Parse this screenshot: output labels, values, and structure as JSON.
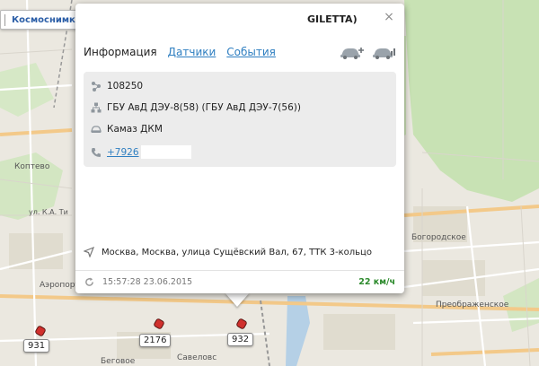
{
  "layer_bar": {
    "selected_layer": "Космоснимки Роскосмос",
    "search_placeholder": ""
  },
  "popup": {
    "title_fragment": "GILETTA)",
    "tabs": [
      {
        "label": "Информация",
        "active": true
      },
      {
        "label": "Датчики",
        "active": false
      },
      {
        "label": "События",
        "active": false
      }
    ],
    "info": {
      "id": "108250",
      "organization": "ГБУ АвД ДЭУ-8(58) (ГБУ АвД ДЭУ-7(56))",
      "vehicle_model": "Камаз ДКМ",
      "phone": "+7926"
    },
    "address": "Москва, Москва, улица Сущёвский Вал, 67, ТТК 3-кольцо",
    "timestamp": "15:57:28 23.06.2015",
    "speed": "22 км/ч"
  },
  "map": {
    "labels": [
      {
        "id": "koptevo",
        "text": "Коптево"
      },
      {
        "id": "ka-ti",
        "text": "ул. К.А. Ти"
      },
      {
        "id": "bogorodskoe",
        "text": "Богородское"
      },
      {
        "id": "airport",
        "text": "Аэропорт"
      },
      {
        "id": "preobr",
        "text": "Преображенское"
      },
      {
        "id": "savelov",
        "text": "Савеловс"
      },
      {
        "id": "begovoe",
        "text": "Беговое"
      }
    ],
    "markers": [
      {
        "id": "931",
        "label": "931"
      },
      {
        "id": "2176",
        "label": "2176"
      },
      {
        "id": "932",
        "label": "932"
      }
    ]
  },
  "colors": {
    "link": "#2f7fc1",
    "speed": "#2c8a2c",
    "marker": "#d0302d",
    "park": "#c8e2b4"
  }
}
